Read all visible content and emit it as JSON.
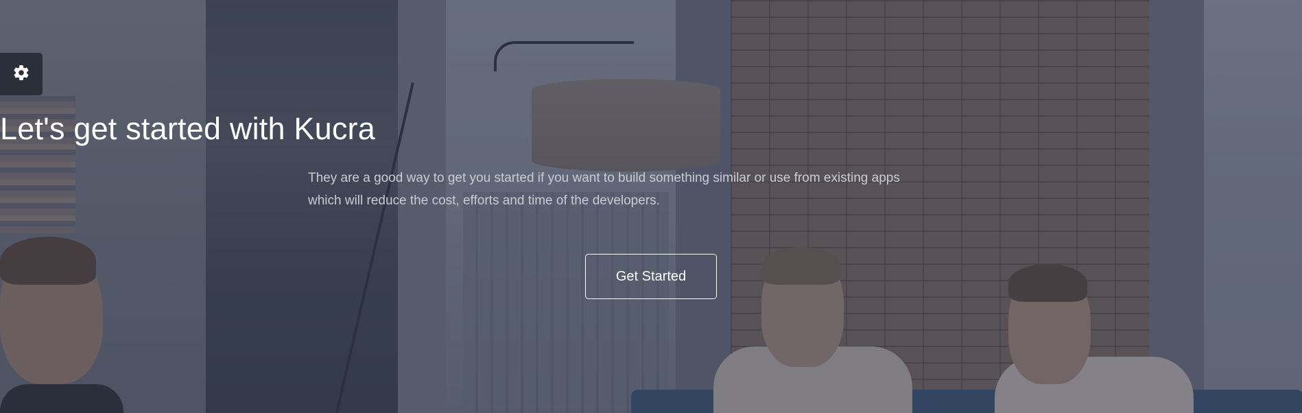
{
  "hero": {
    "title": "Let's get started with Kucra",
    "subtitle_line1": "They are a good way to get you started if you want to build something similar or use from existing apps",
    "subtitle_line2": "which will reduce the cost, efforts and time of the developers.",
    "cta_label": "Get Started"
  },
  "settings": {
    "icon": "gear-icon"
  },
  "colors": {
    "overlay": "#282f42",
    "title": "#ffffff",
    "subtitle": "#c9ccd4",
    "settings_bg": "#2b2f3a"
  }
}
